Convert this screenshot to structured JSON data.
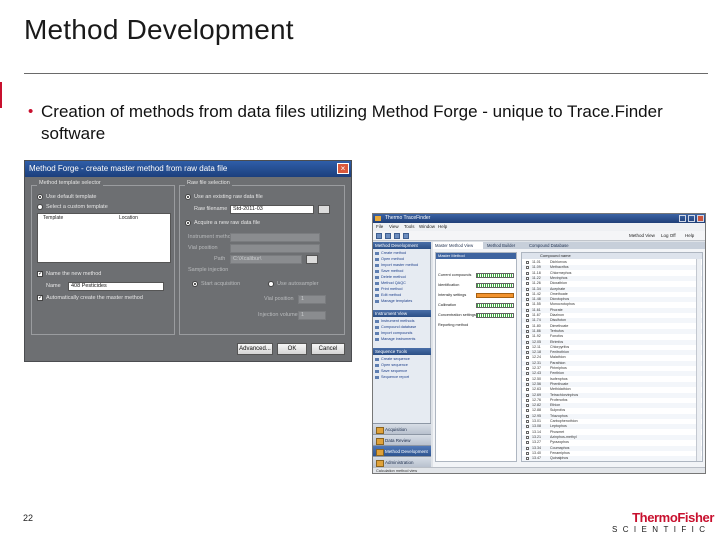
{
  "slide": {
    "title": "Method Development",
    "bullet": "Creation of methods from data files utilizing Method Forge - unique to Trace.Finder software",
    "page_number": "22"
  },
  "brand": {
    "logo_text": "ThermoFisher",
    "logo_sub": "SCIENTIFIC",
    "accent_color": "#c8102e"
  },
  "method_forge_dialog": {
    "title": "Method Forge - create master method from raw data file",
    "template_group": {
      "title": "Method template selector",
      "opt_default": "Use default template",
      "opt_custom": "Select a custom template",
      "col_template": "Template",
      "col_location": "Location",
      "name_new_method_label": "Name the new method",
      "name_label": "Name",
      "name_value": "408 Pesticides",
      "auto_create_label": "Automatically create the master method"
    },
    "raw_file_group": {
      "title": "Raw file selection",
      "opt_existing": "Use an existing raw data file",
      "raw_filename_label": "Raw filename",
      "raw_filename_value": "Std-2011-03",
      "opt_acquire": "Acquire a new raw data file",
      "instrument_method_label": "Instrument method",
      "vial_position_label": "Vial position",
      "path_label": "Path",
      "path_value": "C:\\Xcalibur\\",
      "sample_injection_label": "Sample injection",
      "opt_direct": "Start acquisition",
      "opt_autosampler": "Use autosampler",
      "vial_position_value": "1",
      "injection_volume_label": "Injection volume",
      "injection_volume_value": "1"
    },
    "buttons": {
      "advanced": "Advanced...",
      "ok": "OK",
      "cancel": "Cancel"
    }
  },
  "tracefinder_window": {
    "title": "Thermo TraceFinder",
    "menu": [
      "File",
      "View",
      "Tools",
      "Window",
      "Help"
    ],
    "toolbar_right": [
      "Method View",
      "Log Off",
      "Help"
    ],
    "nav_sections": [
      {
        "header": "Method Development",
        "links": [
          "Create method",
          "Open method",
          "Import master method",
          "Save method",
          "Delete method",
          "Method QAQC",
          "Print method",
          "Edit method",
          "Manage templates"
        ]
      },
      {
        "header": "Instrument View",
        "links": [
          "Instrument methods",
          "Compound database",
          "Import compounds",
          "Manage instruments"
        ]
      },
      {
        "header": "Sequence Tools",
        "links": [
          "Create sequence",
          "Open sequence",
          "Save sequence",
          "Sequence report"
        ]
      }
    ],
    "nav_modes": [
      "Acquisition",
      "Data Review",
      "Method Development",
      "Administration"
    ],
    "active_mode": "Method Development",
    "tabs": [
      "Master Method View",
      "Method Builder",
      "Compound Database"
    ],
    "panel": {
      "header": "Master Method",
      "labels": [
        "Current compounds",
        "Identification",
        "Intensity settings",
        "Calibration",
        "Concentration settings",
        "Reporting method"
      ]
    },
    "list_header": "Compound name",
    "list_rows": [
      {
        "rt": "11.01",
        "name": "Dichlorvos"
      },
      {
        "rt": "11.09",
        "name": "Methacrifos"
      },
      {
        "rt": "11.18",
        "name": "Chlormephos"
      },
      {
        "rt": "11.22",
        "name": "Mevinphos"
      },
      {
        "rt": "11.26",
        "name": "Dioxathion"
      },
      {
        "rt": "11.34",
        "name": "Acephate"
      },
      {
        "rt": "11.42",
        "name": "Omethoate"
      },
      {
        "rt": "11.48",
        "name": "Dicrotophos"
      },
      {
        "rt": "11.55",
        "name": "Monocrotophos"
      },
      {
        "rt": "11.61",
        "name": "Phorate"
      },
      {
        "rt": "11.67",
        "name": "Diazinon"
      },
      {
        "rt": "11.74",
        "name": "Disulfoton"
      },
      {
        "rt": "11.80",
        "name": "Dimethoate"
      },
      {
        "rt": "11.86",
        "name": "Terbufos"
      },
      {
        "rt": "11.92",
        "name": "Fonofos"
      },
      {
        "rt": "12.05",
        "name": "Etrimfos"
      },
      {
        "rt": "12.11",
        "name": "Chlorpyrifos"
      },
      {
        "rt": "12.18",
        "name": "Fenitrothion"
      },
      {
        "rt": "12.24",
        "name": "Malathion"
      },
      {
        "rt": "12.31",
        "name": "Parathion"
      },
      {
        "rt": "12.37",
        "name": "Pirimiphos"
      },
      {
        "rt": "12.43",
        "name": "Fenthion"
      },
      {
        "rt": "12.50",
        "name": "Isofenphos"
      },
      {
        "rt": "12.56",
        "name": "Phenthoate"
      },
      {
        "rt": "12.63",
        "name": "Methidathion"
      },
      {
        "rt": "12.69",
        "name": "Tetrachlorvinphos"
      },
      {
        "rt": "12.76",
        "name": "Profenofos"
      },
      {
        "rt": "12.82",
        "name": "Ethion"
      },
      {
        "rt": "12.88",
        "name": "Sulprofos"
      },
      {
        "rt": "12.95",
        "name": "Triazophos"
      },
      {
        "rt": "13.01",
        "name": "Carbophenothion"
      },
      {
        "rt": "13.08",
        "name": "Leptophos"
      },
      {
        "rt": "13.14",
        "name": "Phosmet"
      },
      {
        "rt": "13.21",
        "name": "Azinphos-methyl"
      },
      {
        "rt": "13.27",
        "name": "Pyrazophos"
      },
      {
        "rt": "13.34",
        "name": "Coumaphos"
      },
      {
        "rt": "13.40",
        "name": "Fenamiphos"
      },
      {
        "rt": "13.47",
        "name": "Quinalphos"
      }
    ],
    "status_text": "Calculation method view"
  }
}
